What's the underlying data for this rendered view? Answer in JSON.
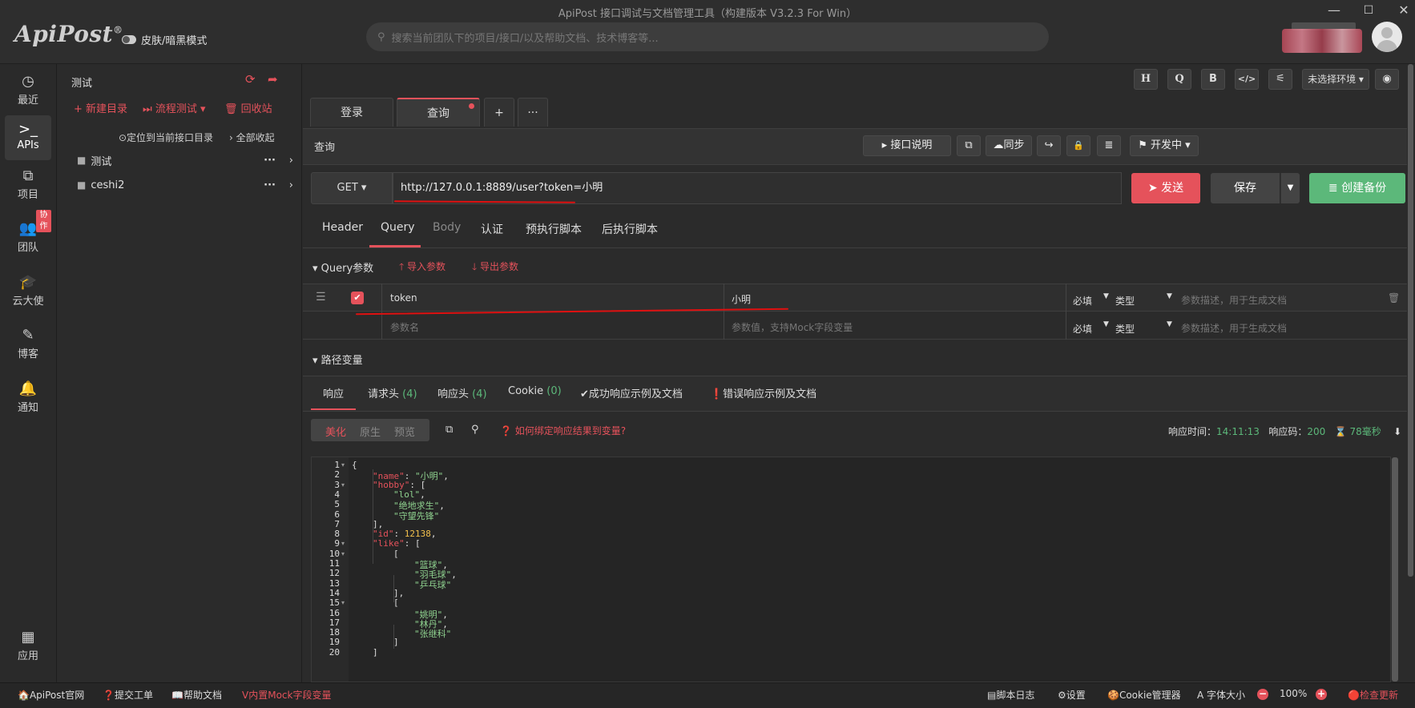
{
  "window": {
    "title": "ApiPost 接口调试与文档管理工具（构建版本 V3.2.3 For Win）",
    "min": "—",
    "max": "☐",
    "close": "✕"
  },
  "brand": {
    "logo": "ApiPost",
    "mark": "®"
  },
  "skin_toggle": {
    "label": "皮肤/暗黑模式"
  },
  "search": {
    "placeholder": "搜索当前团队下的项目/接口/以及帮助文档、技术博客等..."
  },
  "user": {
    "blurred_name": ""
  },
  "nav": {
    "items": [
      {
        "label": "最近",
        "icon": "clock-icon",
        "glyph": "◷"
      },
      {
        "label": "APIs",
        "icon": "terminal-icon",
        "glyph": ">_"
      },
      {
        "label": "项目",
        "icon": "project-icon",
        "glyph": "⧉"
      },
      {
        "label": "团队",
        "icon": "team-icon",
        "glyph": "👥",
        "badge": "协作"
      },
      {
        "label": "云大使",
        "icon": "graduation-cap-icon",
        "glyph": "🎓"
      },
      {
        "label": "博客",
        "icon": "edit-icon",
        "glyph": "✎"
      },
      {
        "label": "通知",
        "icon": "bell-icon",
        "glyph": "🔔"
      },
      {
        "label": "应用",
        "icon": "apps-grid-icon",
        "glyph": "▦"
      }
    ]
  },
  "tree": {
    "title": "测试",
    "new_dir": "+ 新建目录",
    "flow_test": "⏭ 流程测试 ▾",
    "recycle": "🗑 回收站",
    "locate": "⊙定位到当前接口目录",
    "collapse_all": "› 全部收起",
    "folders": [
      {
        "name": "测试"
      },
      {
        "name": "ceshi2"
      }
    ]
  },
  "toolbar": {
    "h": "H",
    "q": "Q",
    "b": "B",
    "code": "</>",
    "sliders": "⚟",
    "env": "未选择环境 ▾",
    "eye": "◉"
  },
  "tabs": [
    {
      "label": "登录"
    },
    {
      "label": "查询"
    }
  ],
  "tab_add": "+",
  "tab_more": "···",
  "request": {
    "name": "查询",
    "doc_btn": "▸ 接口说明",
    "copy_btn": "⧉",
    "sync_btn": "☁同步",
    "share_btn": "↪",
    "lock_btn": "🔒",
    "db_btn": "≣",
    "status_btn": "⚑ 开发中 ▾",
    "method": "GET ▾",
    "url": "http://127.0.0.1:8889/user?token=小明",
    "send": "➤ 发送",
    "save": "保存",
    "save_drop": "▼",
    "backup": "≣ 创建备份"
  },
  "req_tabs": [
    "Header",
    "Query",
    "Body",
    "认证",
    "预执行脚本",
    "后执行脚本"
  ],
  "query": {
    "section": "▾ Query参数",
    "import": "🡑 导入参数",
    "export": "🡓 导出参数",
    "rows": [
      {
        "key": "token",
        "value": "小明",
        "required": "必填",
        "type": "类型",
        "desc_ph": "参数描述，用于生成文档"
      }
    ],
    "new_row": {
      "key_ph": "参数名",
      "value_ph": "参数值，支持Mock字段变量",
      "required": "必填",
      "type": "类型",
      "desc_ph": "参数描述，用于生成文档"
    }
  },
  "path_vars": {
    "section": "▾ 路径变量"
  },
  "resp_tabs": {
    "response": "响应",
    "req_headers": "请求头 ",
    "req_headers_cnt": "(4)",
    "resp_headers": "响应头 ",
    "resp_headers_cnt": "(4)",
    "cookie": "Cookie ",
    "cookie_cnt": "(0)",
    "success_doc": "✔成功响应示例及文档",
    "error_doc": "❗错误响应示例及文档"
  },
  "resp_view": {
    "pretty": "美化",
    "raw": "原生",
    "preview": "预览",
    "bind_help": "❓ 如何绑定响应结果到变量?",
    "time_label": "响应时间：",
    "time": "14:11:13",
    "code_label": "响应码：",
    "code": "200",
    "duration": "78毫秒",
    "hourglass": "⌛",
    "download": "⬇"
  },
  "code_lines": [
    "1",
    "2",
    "3",
    "4",
    "5",
    "6",
    "7",
    "8",
    "9",
    "10",
    "11",
    "12",
    "13",
    "14",
    "15",
    "16",
    "17",
    "18",
    "19",
    "20"
  ],
  "statusbar": {
    "official": "🏠ApiPost官网",
    "ticket": "❓提交工单",
    "help": "📖帮助文档",
    "mock": "Ⅴ内置Mock字段变量",
    "script_log": "▤脚本日志",
    "settings": "⚙设置",
    "cookie_mgr": "🍪Cookie管理器",
    "font_size": "A 字体大小",
    "zoom": "100%",
    "check_update": "🔴检查更新"
  },
  "colors": {
    "accent": "#e5525b",
    "success": "#5cb87a",
    "bg": "#2b2b2b"
  }
}
